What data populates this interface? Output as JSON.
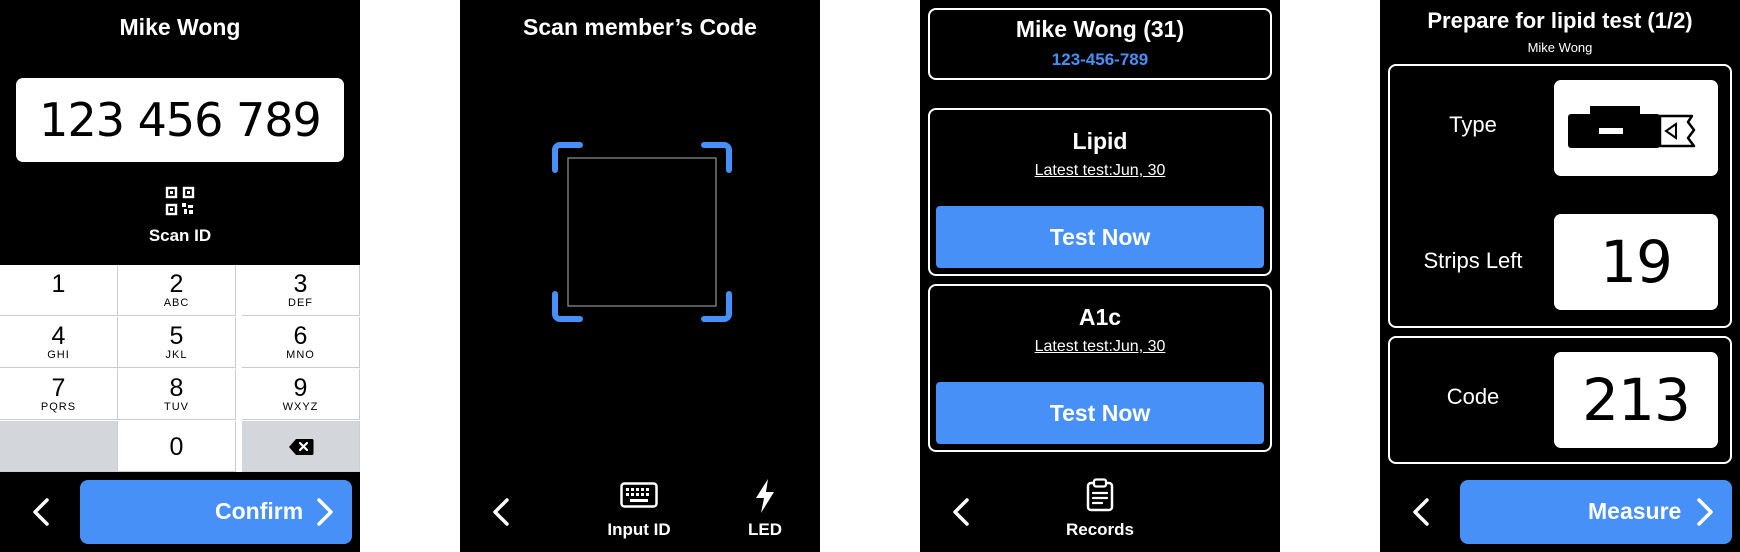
{
  "screen1": {
    "title": "Mike Wong",
    "id_value": "123 456 789",
    "scan_label": "Scan ID",
    "keys": [
      {
        "digit": "1",
        "letters": ""
      },
      {
        "digit": "2",
        "letters": "ABC"
      },
      {
        "digit": "3",
        "letters": "DEF"
      },
      {
        "digit": "4",
        "letters": "GHI"
      },
      {
        "digit": "5",
        "letters": "JKL"
      },
      {
        "digit": "6",
        "letters": "MNO"
      },
      {
        "digit": "7",
        "letters": "PQRS"
      },
      {
        "digit": "8",
        "letters": "TUV"
      },
      {
        "digit": "9",
        "letters": "WXYZ"
      },
      {
        "digit": "0",
        "letters": ""
      }
    ],
    "confirm_label": "Confirm"
  },
  "screen2": {
    "title": "Scan member’s Code",
    "input_label": "Input ID",
    "led_label": "LED"
  },
  "screen3": {
    "member_name": "Mike Wong (31)",
    "member_id": "123-456-789",
    "tests": [
      {
        "name": "Lipid",
        "latest": "Latest test:Jun, 30",
        "button": "Test Now"
      },
      {
        "name": "A1c",
        "latest": "Latest test:Jun, 30",
        "button": "Test Now"
      }
    ],
    "records_label": "Records"
  },
  "screen4": {
    "title": "Prepare for lipid test (1/2)",
    "subtitle": "Mike Wong",
    "type_label": "Type",
    "strips_label": "Strips Left",
    "strips_value": "19",
    "code_label": "Code",
    "code_value": "213",
    "measure_label": "Measure"
  },
  "colors": {
    "accent": "#4790f7",
    "background": "#000000",
    "keypad_gray": "#d3d6da"
  },
  "icons": [
    "chevron-left-icon",
    "chevron-right-icon",
    "qr-code-icon",
    "backspace-icon",
    "keyboard-icon",
    "flash-icon",
    "clipboard-icon",
    "test-strip-icon"
  ]
}
